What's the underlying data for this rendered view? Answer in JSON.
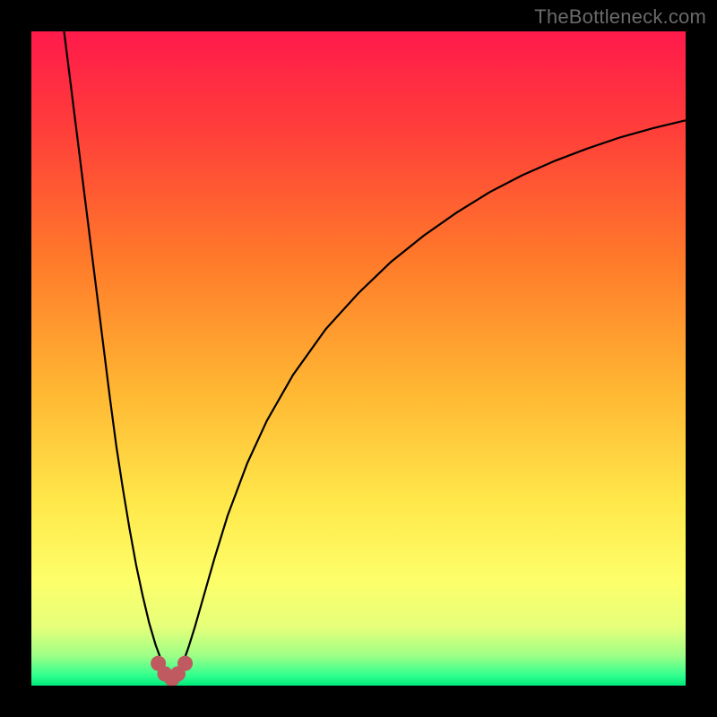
{
  "watermark": "TheBottleneck.com",
  "colors": {
    "bg_black": "#000000",
    "curve_stroke": "#000000",
    "marker_fill": "#bf5a61",
    "gradient_stops": [
      {
        "offset": 0.0,
        "color": "#ff1a4b"
      },
      {
        "offset": 0.15,
        "color": "#ff3e3a"
      },
      {
        "offset": 0.35,
        "color": "#ff7a2a"
      },
      {
        "offset": 0.55,
        "color": "#ffb733"
      },
      {
        "offset": 0.72,
        "color": "#ffe84a"
      },
      {
        "offset": 0.84,
        "color": "#fdff6a"
      },
      {
        "offset": 0.91,
        "color": "#e6ff7a"
      },
      {
        "offset": 0.955,
        "color": "#9cff86"
      },
      {
        "offset": 0.985,
        "color": "#2fff8f"
      },
      {
        "offset": 1.0,
        "color": "#00e87a"
      }
    ]
  },
  "chart_data": {
    "type": "line",
    "title": "",
    "xlabel": "",
    "ylabel": "",
    "xlim": [
      0,
      100
    ],
    "ylim": [
      0,
      100
    ],
    "notch_x": 21.5,
    "left_curve": {
      "x": [
        5,
        6,
        7,
        8,
        9,
        10,
        11,
        12,
        13,
        14,
        15,
        16,
        17,
        18,
        19,
        20,
        21,
        21.5
      ],
      "y": [
        100,
        92,
        84,
        76,
        68,
        60,
        52,
        44,
        36.5,
        30,
        24,
        18.5,
        13.8,
        9.6,
        6.2,
        3.5,
        1.4,
        0.6
      ]
    },
    "right_curve": {
      "x": [
        21.5,
        22,
        23,
        24,
        25,
        26,
        28,
        30,
        33,
        36,
        40,
        45,
        50,
        55,
        60,
        65,
        70,
        75,
        80,
        85,
        90,
        95,
        100
      ],
      "y": [
        0.6,
        1.2,
        3.0,
        5.8,
        9.0,
        12.5,
        19.5,
        26.0,
        34.0,
        40.5,
        47.5,
        54.5,
        60.0,
        64.8,
        68.8,
        72.3,
        75.4,
        78.0,
        80.2,
        82.1,
        83.8,
        85.2,
        86.4
      ]
    },
    "markers": [
      {
        "x": 19.4,
        "y": 3.4
      },
      {
        "x": 20.4,
        "y": 1.8
      },
      {
        "x": 21.5,
        "y": 1.0
      },
      {
        "x": 22.4,
        "y": 1.8
      },
      {
        "x": 23.5,
        "y": 3.4
      }
    ]
  }
}
